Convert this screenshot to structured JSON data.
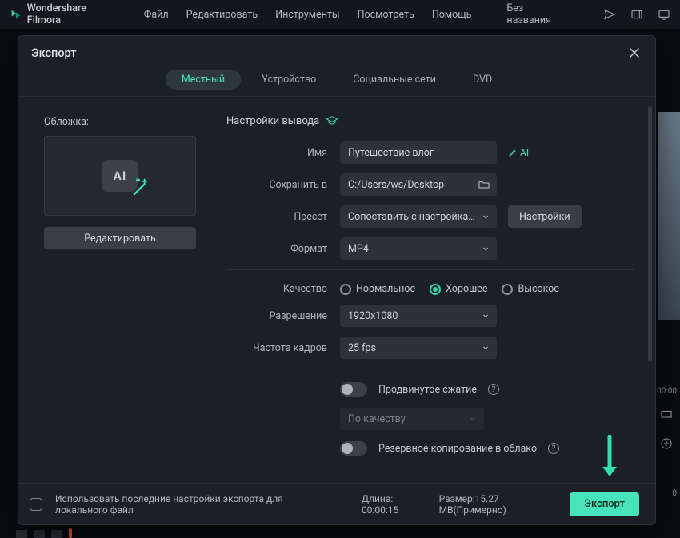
{
  "app": {
    "name": "Wondershare Filmora",
    "menus": [
      "Файл",
      "Редактировать",
      "Инструменты",
      "Посмотреть",
      "Помощь"
    ],
    "project_title": "Без названия"
  },
  "bg": {
    "time1": ":00:00",
    "time2": "0"
  },
  "modal": {
    "title": "Экспорт",
    "tabs": {
      "local": "Местный",
      "device": "Устройство",
      "social": "Социальные сети",
      "dvd": "DVD"
    },
    "thumbnail": {
      "label": "Обложка:",
      "badge": "AI",
      "edit": "Редактировать"
    },
    "output_section": "Настройки вывода",
    "fields": {
      "name_label": "Имя",
      "name_value": "Путешествие влог",
      "ai_chip": "AI",
      "save_label": "Сохранить в",
      "save_value": "C:/Users/ws/Desktop",
      "preset_label": "Пресет",
      "preset_value": "Сопоставить с настройками проекта",
      "preset_settings": "Настройки",
      "format_label": "Формат",
      "format_value": "MP4",
      "quality_label": "Качество",
      "quality_options": {
        "normal": "Нормальное",
        "good": "Хорошее",
        "high": "Высокое"
      },
      "resolution_label": "Разрешение",
      "resolution_value": "1920x1080",
      "fps_label": "Частота кадров",
      "fps_value": "25 fps",
      "adv_compress": "Продвинутое сжатие",
      "by_quality": "По качеству",
      "cloud_backup": "Резервное копирование в облако"
    },
    "footer": {
      "use_last": "Использовать последние настройки экспорта для локального файл",
      "length_label": "Длина:",
      "length_value": "00:00:15",
      "size_label": "Размер:",
      "size_value": "15.27 MB(Примерно)",
      "export": "Экспорт"
    }
  }
}
